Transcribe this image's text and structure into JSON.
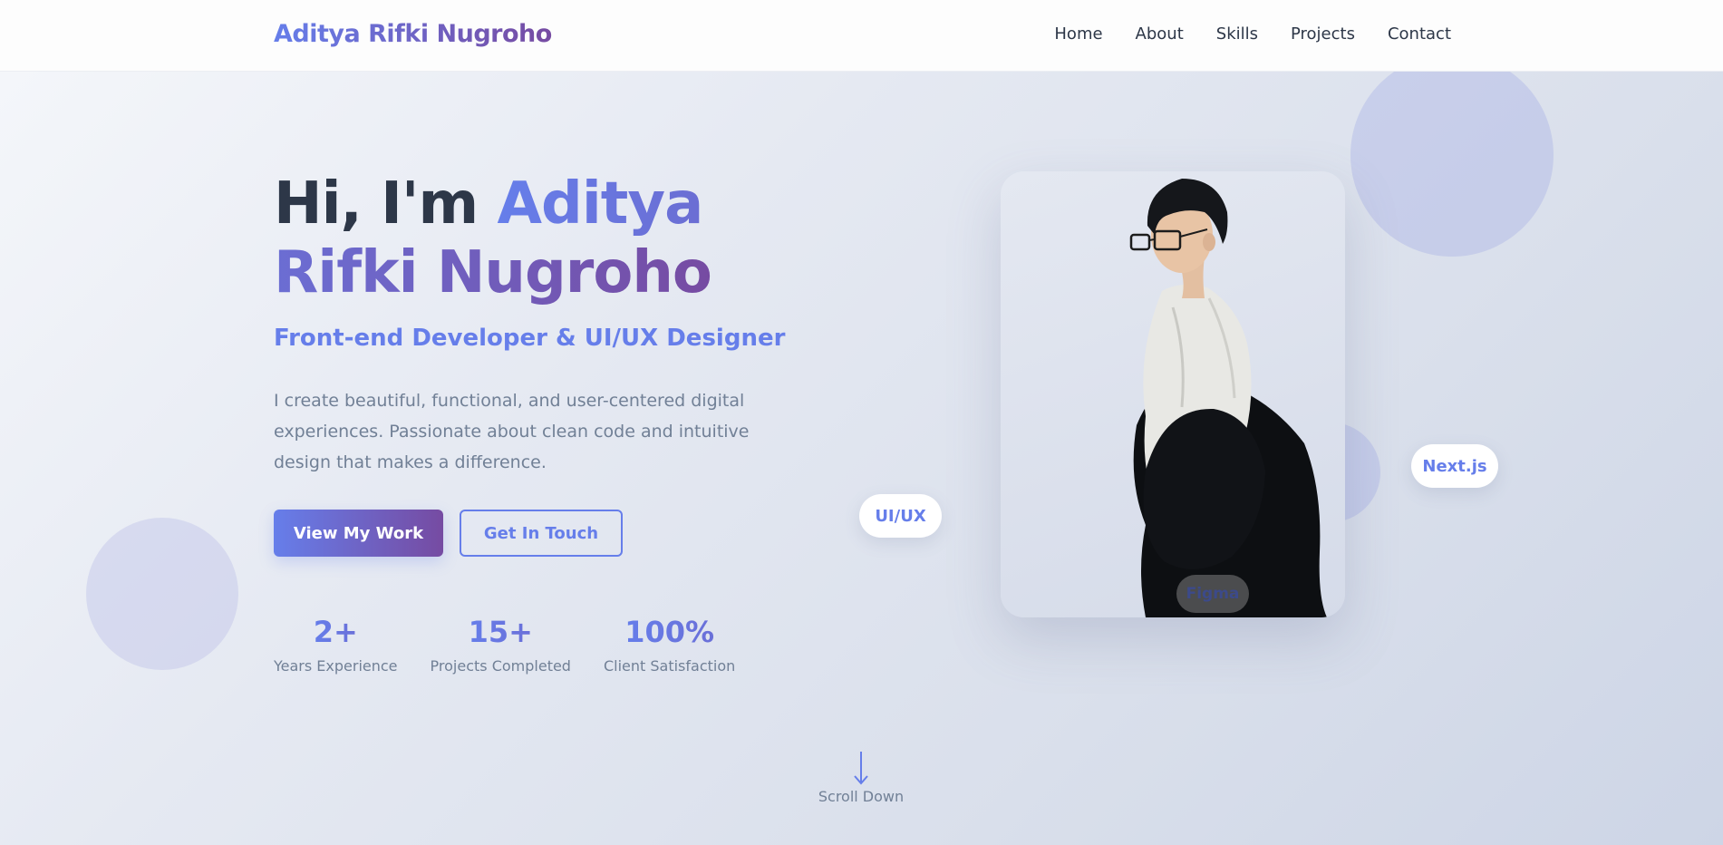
{
  "nav": {
    "logo": "Aditya Rifki Nugroho",
    "links": [
      "Home",
      "About",
      "Skills",
      "Projects",
      "Contact"
    ]
  },
  "hero": {
    "greeting": "Hi, I'm ",
    "name": "Aditya Rifki Nugroho",
    "subtitle": "Front-end Developer & UI/UX Designer",
    "description": "I create beautiful, functional, and user-centered digital experiences. Passionate about clean code and intuitive design that makes a difference.",
    "primary_button": "View My Work",
    "secondary_button": "Get In Touch",
    "stats": [
      {
        "number": "2+",
        "label": "Years Experience"
      },
      {
        "number": "15+",
        "label": "Projects Completed"
      },
      {
        "number": "100%",
        "label": "Client Satisfaction"
      }
    ]
  },
  "badges": {
    "uiux": "UI/UX",
    "nextjs": "Next.js",
    "figma": "Figma"
  },
  "scroll": {
    "label": "Scroll Down",
    "icon": "arrow-down-icon"
  },
  "colors": {
    "accent_start": "#667eea",
    "accent_end": "#764ba2",
    "heading": "#2d3748",
    "muted": "#718096"
  }
}
